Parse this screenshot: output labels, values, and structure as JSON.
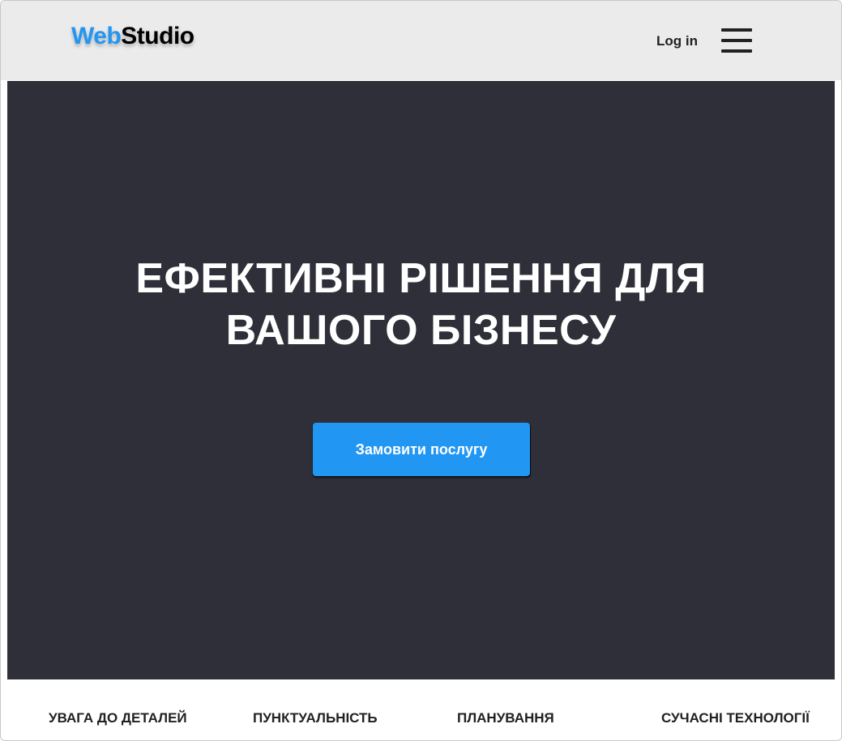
{
  "header": {
    "logo": {
      "part_a": "Web",
      "part_b": "Studio"
    },
    "login_label": "Log in",
    "menu_icon": "hamburger-menu-icon"
  },
  "hero": {
    "title_line1": "ЕФЕКТИВНІ РІШЕННЯ ДЛЯ",
    "title_line2": "ВАШОГО БІЗНЕСУ",
    "cta_label": "Замовити послугу"
  },
  "features": [
    {
      "label": "УВАГА ДО ДЕТАЛЕЙ"
    },
    {
      "label": "ПУНКТУАЛЬНІСТЬ"
    },
    {
      "label": "ПЛАНУВАННЯ"
    },
    {
      "label": "СУЧАСНІ ТЕХНОЛОГІЇ"
    }
  ],
  "colors": {
    "accent": "#2196f3",
    "header_bg": "#ebebeb",
    "hero_bg": "#2f2f39",
    "text_dark": "#212121"
  }
}
